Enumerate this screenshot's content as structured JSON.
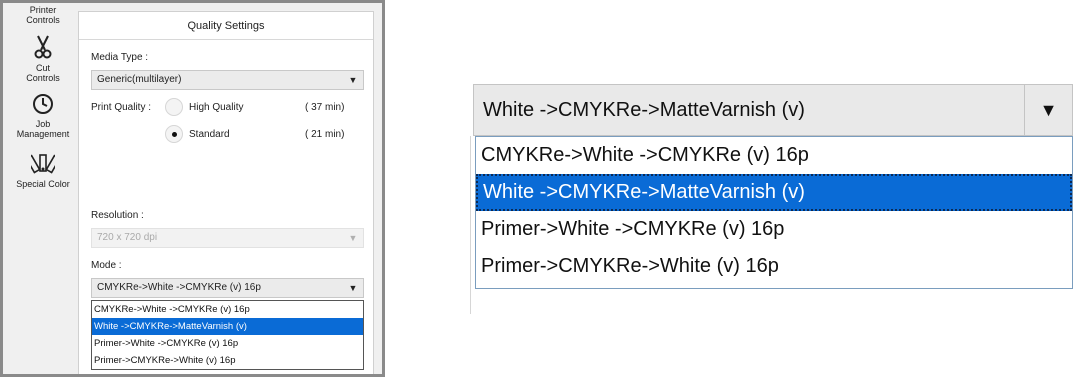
{
  "nav": {
    "items": [
      {
        "label_1": "Printer",
        "label_2": "Controls",
        "icon": "printer-controls-icon"
      },
      {
        "label_1": "Cut",
        "label_2": "Controls",
        "icon": "scissors-icon"
      },
      {
        "label_1": "Job",
        "label_2": "Management",
        "icon": "clock-icon"
      },
      {
        "label_1": "Special Color",
        "label_2": "",
        "icon": "color-swatch-fan-icon"
      }
    ]
  },
  "panel": {
    "title": "Quality Settings",
    "media_type_label": "Media Type :",
    "media_type_value": "Generic(multilayer)",
    "print_quality_label": "Print Quality :",
    "quality_options": [
      {
        "label": "High Quality",
        "time": "( 37 min)",
        "selected": false
      },
      {
        "label": "Standard",
        "time": "( 21 min)",
        "selected": true
      }
    ],
    "resolution_label": "Resolution :",
    "resolution_value": "720 x 720 dpi",
    "mode_label": "Mode :",
    "mode_value": "CMYKRe->White ->CMYKRe (v) 16p",
    "mode_options": [
      "CMYKRe->White ->CMYKRe (v) 16p",
      "White ->CMYKRe->MatteVarnish (v)",
      "Primer->White ->CMYKRe (v) 16p",
      "Primer->CMYKRe->White (v) 16p"
    ],
    "mode_selected_index": 1,
    "arrow_glyph": "▼"
  },
  "zoom": {
    "combo_value": "White ->CMYKRe->MatteVarnish (v)",
    "arrow_glyph": "▼",
    "options": [
      "CMYKRe->White ->CMYKRe (v) 16p",
      "White ->CMYKRe->MatteVarnish (v)",
      "Primer->White ->CMYKRe (v) 16p",
      "Primer->CMYKRe->White (v) 16p"
    ],
    "selected_index": 1
  },
  "colors": {
    "selection": "#0a6bd6",
    "window_border": "#8a8a8a"
  }
}
